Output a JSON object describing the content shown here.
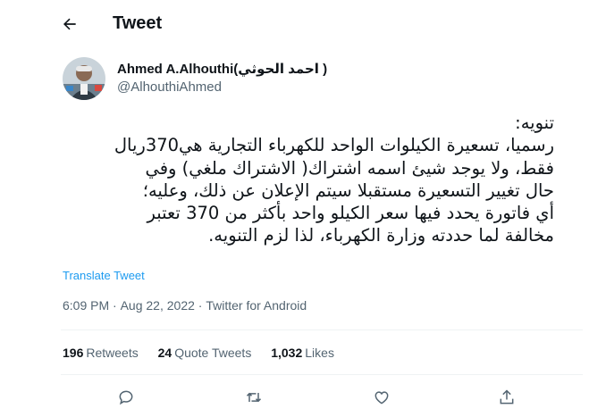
{
  "header": {
    "title": "Tweet",
    "back_icon": "arrow-left-icon"
  },
  "author": {
    "name": "Ahmed A.Alhouthi(احمد الحوثي )",
    "handle": "@AlhouthiAhmed"
  },
  "tweet": {
    "text": "تنويه:\nرسميا، تسعيرة الكيلوات الواحد للكهرباء التجارية هي370ريال\nفقط، ولا يوجد شيئ اسمه اشتراك( الاشتراك ملغي) وفي\nحال تغيير التسعيرة مستقبلا سيتم الإعلان عن ذلك، وعليه؛\nأي فاتورة يحدد فيها سعر الكيلو واحد بأكثر من 370  تعتبر\nمخالفة لما حددته وزارة الكهرباء، لذا لزم التنويه.",
    "translate_label": "Translate Tweet",
    "time": "6:09 PM",
    "separator": "·",
    "date": "Aug 22, 2022",
    "source": "Twitter for Android"
  },
  "stats": {
    "retweets_count": "196",
    "retweets_label": "Retweets",
    "quotes_count": "24",
    "quotes_label": "Quote Tweets",
    "likes_count": "1,032",
    "likes_label": "Likes"
  },
  "actions": [
    "reply-icon",
    "retweet-icon",
    "like-icon",
    "share-icon"
  ],
  "colors": {
    "link": "#1d9bf0",
    "secondary_text": "#536471",
    "divider": "#eff3f4"
  }
}
